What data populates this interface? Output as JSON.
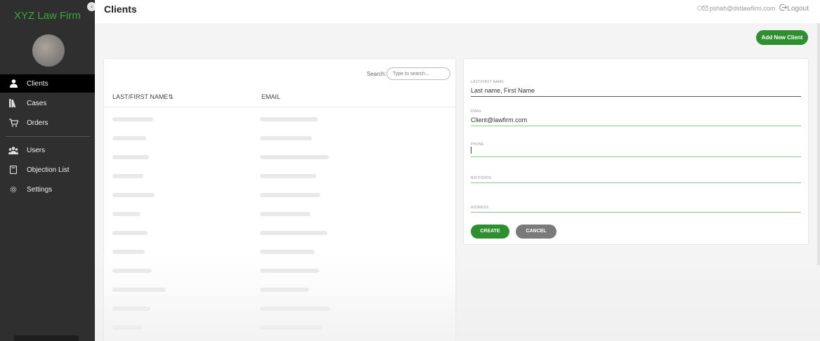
{
  "sidebar": {
    "brand": "XYZ Law Firm",
    "items": [
      {
        "label": "Clients",
        "icon": "user-icon"
      },
      {
        "label": "Cases",
        "icon": "books-icon"
      },
      {
        "label": "Orders",
        "icon": "cart-icon"
      },
      {
        "label": "Users",
        "icon": "users-icon"
      },
      {
        "label": "Objection List",
        "icon": "book-icon"
      },
      {
        "label": "Settings",
        "icon": "gear-icon"
      }
    ]
  },
  "header": {
    "title": "Clients",
    "user_email": "pshah@dstlawfirm.com",
    "logout_label": "Logout"
  },
  "actions": {
    "add_new_client": "Add New Client"
  },
  "list": {
    "search_label": "Search:",
    "search_placeholder": "Type to search...",
    "columns": [
      "LAST/FIRST NAME⇅",
      "EMAIL"
    ]
  },
  "form": {
    "name_label": "LAST/FIRST NAME",
    "name_value": "Last name, First Name",
    "email_label": "EMAIL",
    "email_value": "Client@lawfirm.com",
    "phone_label": "PHONE",
    "birthdate_label": "BIRTHDATE",
    "address_label": "ADDRESS",
    "create_label": "CREATE",
    "cancel_label": "CANCEL"
  },
  "colors": {
    "accent": "#2e8f2e",
    "sidebar": "#2f2f2f",
    "brand": "#39a839"
  }
}
